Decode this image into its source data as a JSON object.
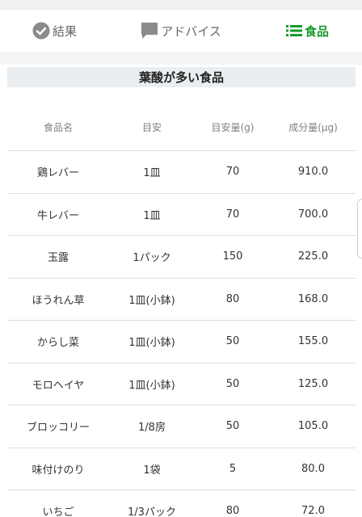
{
  "tabs": {
    "result": {
      "label": "結果",
      "icon": "check-circle-icon"
    },
    "advice": {
      "label": "アドバイス",
      "icon": "speech-bubble-icon"
    },
    "food": {
      "label": "食品",
      "icon": "list-icon",
      "active": true
    }
  },
  "colors": {
    "accent": "#1a9a2c",
    "section_bg": "#eaeef0"
  },
  "section": {
    "title": "葉酸が多い食品"
  },
  "table": {
    "headers": {
      "name": "食品名",
      "portion": "目安",
      "grams": "目安量(g)",
      "amount": "成分量(μg)"
    },
    "rows": [
      {
        "name": "鶏レバー",
        "portion": "1皿",
        "grams": "70",
        "amount": "910.0"
      },
      {
        "name": "牛レバー",
        "portion": "1皿",
        "grams": "70",
        "amount": "700.0"
      },
      {
        "name": "玉露",
        "portion": "1パック",
        "grams": "150",
        "amount": "225.0"
      },
      {
        "name": "ほうれん草",
        "portion": "1皿(小鉢)",
        "grams": "80",
        "amount": "168.0"
      },
      {
        "name": "からし菜",
        "portion": "1皿(小鉢)",
        "grams": "50",
        "amount": "155.0"
      },
      {
        "name": "モロヘイヤ",
        "portion": "1皿(小鉢)",
        "grams": "50",
        "amount": "125.0"
      },
      {
        "name": "ブロッコリー",
        "portion": "1/8房",
        "grams": "50",
        "amount": "105.0"
      },
      {
        "name": "味付けのり",
        "portion": "1袋",
        "grams": "5",
        "amount": "80.0"
      },
      {
        "name": "いちご",
        "portion": "1/3パック",
        "grams": "80",
        "amount": "72.0"
      }
    ]
  }
}
